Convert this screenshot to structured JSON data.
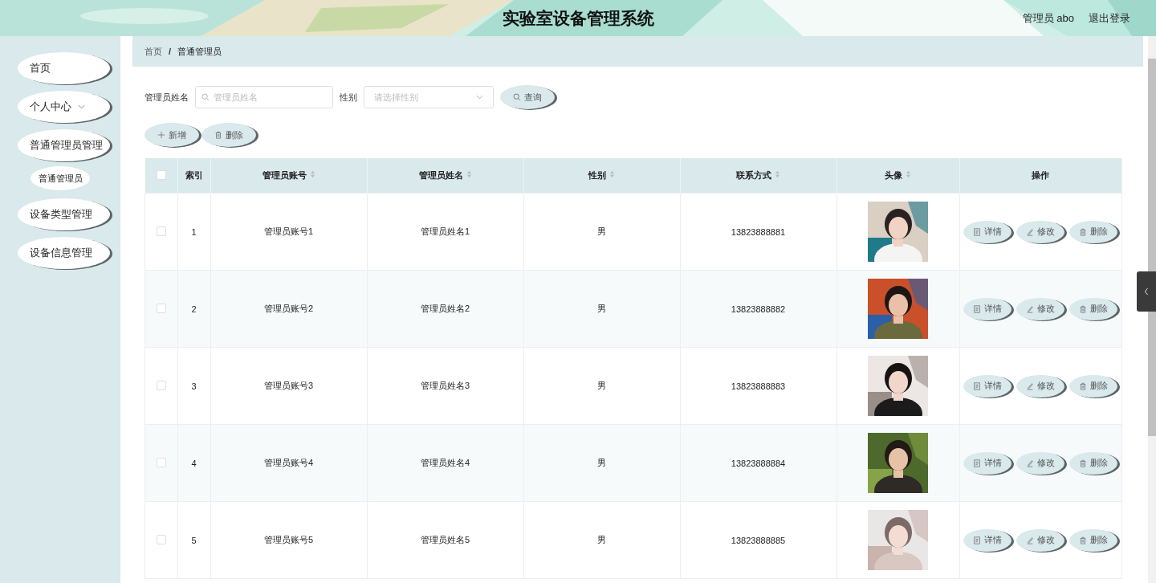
{
  "header": {
    "title": "实验室设备管理系统",
    "user": "管理员 abo",
    "logout": "退出登录"
  },
  "sidebar": {
    "items": [
      {
        "label": "首页",
        "kind": "link",
        "selected": false
      },
      {
        "label": "个人中心",
        "kind": "submenu",
        "selected": false
      },
      {
        "label": "普通管理员管理",
        "kind": "group",
        "selected": false,
        "children": [
          {
            "label": "普通管理员",
            "selected": false
          }
        ]
      },
      {
        "label": "设备类型管理",
        "kind": "link",
        "selected": false
      },
      {
        "label": "设备信息管理",
        "kind": "link",
        "selected": false
      }
    ]
  },
  "breadcrumb": {
    "items": [
      "首页",
      "普通管理员"
    ],
    "separator": "/"
  },
  "filters": {
    "name_label": "管理员姓名",
    "name_placeholder": "管理员姓名",
    "gender_label": "性别",
    "gender_placeholder": "请选择性别",
    "search_button": "查询"
  },
  "actions": [
    "新增",
    "删除"
  ],
  "table": {
    "select_all_checked": false,
    "columns": [
      {
        "label": "索引",
        "sortable": false
      },
      {
        "label": "管理员账号",
        "sortable": true
      },
      {
        "label": "管理员姓名",
        "sortable": true
      },
      {
        "label": "性别",
        "sortable": true
      },
      {
        "label": "联系方式",
        "sortable": true
      },
      {
        "label": "头像",
        "sortable": true
      },
      {
        "label": "操作",
        "sortable": false
      }
    ],
    "rows": [
      {
        "checked": false,
        "index": "1",
        "account": "管理员账号1",
        "name": "管理员姓名1",
        "gender": "男",
        "phone": "13823888881",
        "buttons": [
          "详情",
          "修改",
          "删除"
        ]
      },
      {
        "checked": false,
        "index": "2",
        "account": "管理员账号2",
        "name": "管理员姓名2",
        "gender": "男",
        "phone": "13823888882",
        "buttons": [
          "详情",
          "修改",
          "删除"
        ]
      },
      {
        "checked": false,
        "index": "3",
        "account": "管理员账号3",
        "name": "管理员姓名3",
        "gender": "男",
        "phone": "13823888883",
        "buttons": [
          "详情",
          "修改",
          "删除"
        ]
      },
      {
        "checked": false,
        "index": "4",
        "account": "管理员账号4",
        "name": "管理员姓名4",
        "gender": "男",
        "phone": "13823888884",
        "buttons": [
          "详情",
          "修改",
          "删除"
        ]
      },
      {
        "checked": false,
        "index": "5",
        "account": "管理员账号5",
        "name": "管理员姓名5",
        "gender": "男",
        "phone": "13823888885",
        "buttons": [
          "详情",
          "修改",
          "删除"
        ]
      }
    ]
  }
}
